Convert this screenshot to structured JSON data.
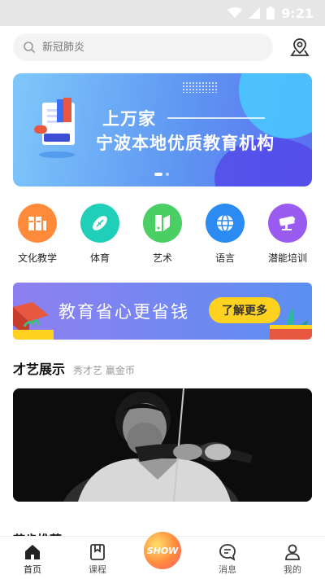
{
  "status_bar": {
    "time": "9:21"
  },
  "search": {
    "placeholder": "新冠肺炎"
  },
  "banner": {
    "line1": "上万家",
    "line2": "宁波本地优质教育机构"
  },
  "categories": [
    {
      "label": "文化教学",
      "icon": "book-grid-icon",
      "color": "#ff8a3a"
    },
    {
      "label": "体育",
      "icon": "rugby-ball-icon",
      "color": "#1fcfb8"
    },
    {
      "label": "艺术",
      "icon": "palette-icon",
      "color": "#49cf63"
    },
    {
      "label": "语言",
      "icon": "globe-icon",
      "color": "#2c8af3"
    },
    {
      "label": "潜能培训",
      "icon": "camera-icon",
      "color": "#9a5cf0"
    }
  ],
  "promo": {
    "text": "教育省心更省钱",
    "button": "了解更多"
  },
  "talent_section": {
    "title": "才艺展示",
    "subtitle": "秀才艺 赢金币"
  },
  "next_section": {
    "title": "节肯推荐"
  },
  "tabbar": [
    {
      "label": "首页",
      "icon": "home-icon",
      "active": true
    },
    {
      "label": "课程",
      "icon": "bookmark-icon"
    },
    {
      "label": "SHOW",
      "icon": "show-icon"
    },
    {
      "label": "消息",
      "icon": "message-icon"
    },
    {
      "label": "我的",
      "icon": "user-icon"
    }
  ]
}
